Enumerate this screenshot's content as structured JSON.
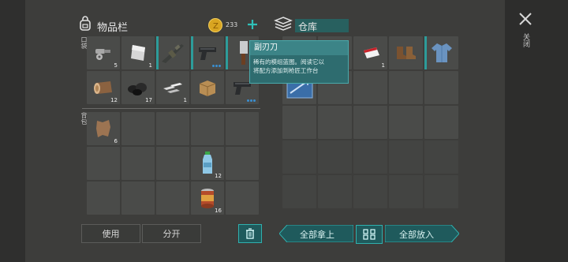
{
  "header": {
    "inventory_title": "物品栏",
    "coins": "233",
    "storage_title": "仓库"
  },
  "pockets_label": "口袋",
  "backpack_label": "背包",
  "close_label": "关闭",
  "pockets": [
    {
      "icon": "bolts-icon",
      "qty": "5"
    },
    {
      "icon": "metal-sheet-icon",
      "qty": "1"
    },
    {
      "icon": "rifle-icon",
      "qty": ""
    },
    {
      "icon": "pistol-icon",
      "qty": ""
    },
    {
      "icon": "cleaver-icon",
      "qty": ""
    },
    {
      "icon": "wood-log-icon",
      "qty": "12"
    },
    {
      "icon": "coal-icon",
      "qty": "17"
    },
    {
      "icon": "iron-bars-icon",
      "qty": "1"
    },
    {
      "icon": "cardboard-box-icon",
      "qty": ""
    },
    {
      "icon": "pistol-icon",
      "qty": ""
    }
  ],
  "backpack": [
    {
      "icon": "leather-icon",
      "qty": "6"
    },
    {
      "icon": "",
      "qty": ""
    },
    {
      "icon": "",
      "qty": ""
    },
    {
      "icon": "",
      "qty": ""
    },
    {
      "icon": "",
      "qty": ""
    },
    {
      "icon": "",
      "qty": ""
    },
    {
      "icon": "",
      "qty": ""
    },
    {
      "icon": "",
      "qty": ""
    },
    {
      "icon": "water-bottle-icon",
      "qty": "12"
    },
    {
      "icon": "",
      "qty": ""
    },
    {
      "icon": "",
      "qty": ""
    },
    {
      "icon": "",
      "qty": ""
    },
    {
      "icon": "",
      "qty": ""
    },
    {
      "icon": "canned-food-icon",
      "qty": "16"
    },
    {
      "icon": "",
      "qty": ""
    }
  ],
  "storage": [
    {
      "icon": "",
      "qty": ""
    },
    {
      "icon": "",
      "qty": ""
    },
    {
      "icon": "cigarettes-icon",
      "qty": "1"
    },
    {
      "icon": "boots-icon",
      "qty": ""
    },
    {
      "icon": "shirt-icon",
      "qty": ""
    },
    {
      "icon": "blueprint-icon",
      "qty": ""
    },
    {
      "icon": "",
      "qty": ""
    },
    {
      "icon": "",
      "qty": ""
    },
    {
      "icon": "",
      "qty": ""
    },
    {
      "icon": "",
      "qty": ""
    }
  ],
  "tooltip": {
    "title": "副刃刀",
    "line1": "稀有的模组蓝图。阅读它以",
    "line2": "将配方添加到枪匠工作台"
  },
  "buttons": {
    "use": "使用",
    "split": "分开",
    "take_all": "全部拿上",
    "put_all": "全部放入"
  }
}
